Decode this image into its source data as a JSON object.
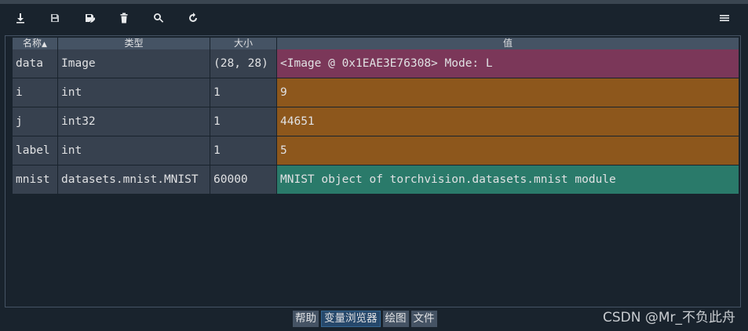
{
  "toolbar": {
    "icons": [
      "import-data-icon",
      "save-icon",
      "save-as-icon",
      "remove-all-icon",
      "search-icon",
      "refresh-icon",
      "options-menu-icon"
    ]
  },
  "table": {
    "headers": {
      "name": "名称",
      "type": "类型",
      "size": "大小",
      "value": "值"
    },
    "sort_indicator": "▲",
    "rows": [
      {
        "name": "data",
        "type": "Image",
        "size": "(28, 28)",
        "value": "<Image @ 0x1EAE3E76308>  Mode: L",
        "color": "#7b3759"
      },
      {
        "name": "i",
        "type": "int",
        "size": "1",
        "value": "9",
        "color": "#8d571c"
      },
      {
        "name": "j",
        "type": "int32",
        "size": "1",
        "value": "44651",
        "color": "#8d571c"
      },
      {
        "name": "label",
        "type": "int",
        "size": "1",
        "value": "5",
        "color": "#8d571c"
      },
      {
        "name": "mnist",
        "type": "datasets.mnist.MNIST",
        "size": "60000",
        "value": "MNIST object of torchvision.datasets.mnist module",
        "color": "#2a7a6a"
      }
    ]
  },
  "bottom_tabs": [
    "帮助",
    "变量浏览器",
    "绘图",
    "文件"
  ],
  "active_tab": "变量浏览器",
  "watermark": "CSDN @Mr_不负此舟"
}
